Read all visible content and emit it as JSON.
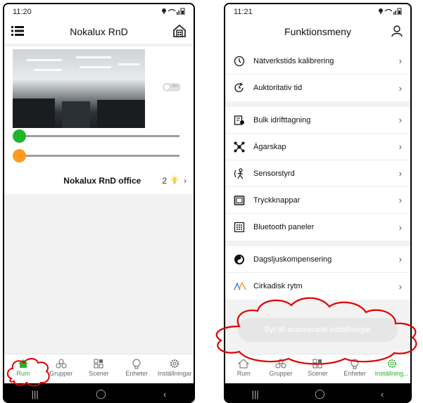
{
  "left": {
    "status_time": "11:20",
    "title": "Nokalux RnD",
    "toggle_text": "OFF",
    "room_name": "Nokalux RnD office",
    "room_count": "2",
    "slider_brightness_level": 0,
    "slider_color_level": 0,
    "colors": {
      "green": "#21b52c",
      "orange": "#ff9a1f"
    },
    "nav": [
      {
        "label": "Rum",
        "icon": "home-icon",
        "active": true
      },
      {
        "label": "Grupper",
        "icon": "groups-icon",
        "active": false
      },
      {
        "label": "Scener",
        "icon": "scenes-icon",
        "active": false
      },
      {
        "label": "Enheter",
        "icon": "bulb-icon",
        "active": false
      },
      {
        "label": "Inställningar",
        "icon": "settings-icon",
        "active": false
      }
    ]
  },
  "right": {
    "status_time": "11:21",
    "title": "Funktionsmeny",
    "groups": [
      [
        {
          "label": "Nätverkstids kalibrering",
          "icon": "clock-icon"
        },
        {
          "label": "Auktoritativ tid",
          "icon": "refresh-clock-icon"
        }
      ],
      [
        {
          "label": "Bulk idrifttagning",
          "icon": "bulk-commission-icon"
        },
        {
          "label": "Ägarskap",
          "icon": "ownership-icon"
        },
        {
          "label": "Sensorstyrd",
          "icon": "sensor-icon"
        },
        {
          "label": "Tryckknappar",
          "icon": "pushbutton-icon"
        },
        {
          "label": "Bluetooth paneler",
          "icon": "bluetooth-panel-icon"
        }
      ],
      [
        {
          "label": "Dagsljuskompensering",
          "icon": "daylight-icon"
        },
        {
          "label": "Cirkadisk rytm",
          "icon": "circadian-icon"
        }
      ]
    ],
    "advanced_button": "Byt till avancerade inställningar",
    "nav": [
      {
        "label": "Rum",
        "icon": "home-icon",
        "active": false
      },
      {
        "label": "Grupper",
        "icon": "groups-icon",
        "active": false
      },
      {
        "label": "Scener",
        "icon": "scenes-icon",
        "active": false
      },
      {
        "label": "Enheter",
        "icon": "bulb-icon",
        "active": false
      },
      {
        "label": "Inställning...",
        "icon": "settings-icon",
        "active": true
      }
    ]
  }
}
